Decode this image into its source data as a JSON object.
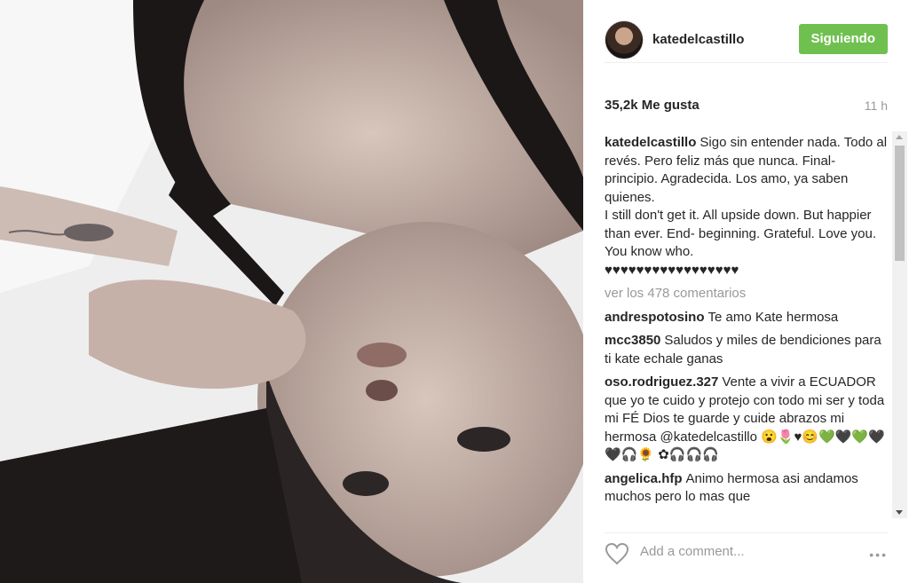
{
  "post": {
    "image_alt": "photo",
    "header": {
      "username": "katedelcastillo",
      "follow_label": "Siguiendo"
    },
    "likes_label": "35,2k Me gusta",
    "time_label": "11 h",
    "caption": {
      "user": "katedelcastillo",
      "text": "Sigo sin entender nada. Todo al revés. Pero feliz más que nunca. Final- principio. Agradecida. Los amo, ya saben quienes.",
      "text_en": "I still don't get it. All upside down. But happier than ever. End- beginning. Grateful. Love you. You know who.",
      "hearts": "♥♥♥♥♥♥♥♥♥♥♥♥♥♥♥♥♥"
    },
    "view_comments_label": "ver los 478 comentarios",
    "comments": [
      {
        "user": "andrespotosino",
        "text": "Te amo Kate hermosa"
      },
      {
        "user": "mcc3850",
        "text": "Saludos y miles de bendiciones para ti kate echale ganas"
      },
      {
        "user": "oso.rodriguez.327",
        "text": "Vente a vivir a ECUADOR que yo te cuido y protejo con todo mi ser y toda mi FÉ Dios te guarde y cuide abrazos mi hermosa @katedelcastillo 😮🌷♥😊💚🖤💚🖤🖤🎧🌻 ✿🎧🎧🎧"
      },
      {
        "user": "angelica.hfp",
        "text": "Animo hermosa asi andamos muchos pero lo mas que"
      }
    ],
    "add_comment_placeholder": "Add a comment...",
    "more_options": "•••"
  },
  "icons": {
    "like": "heart-outline-icon",
    "options": "more-options-icon"
  },
  "colors": {
    "follow_button": "#70c050",
    "muted_text": "#999999"
  }
}
